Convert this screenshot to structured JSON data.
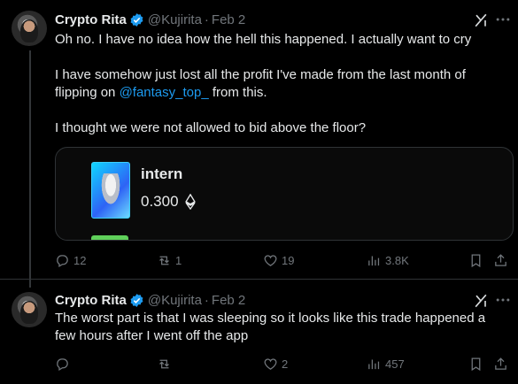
{
  "tweets": [
    {
      "author": {
        "name": "Crypto Rita",
        "handle": "@Kujirita",
        "date": "Feb 2",
        "verified": true
      },
      "text_before": "Oh no.  I have no idea how the hell this happened. I actually want to cry\n\nI have somehow just lost all the profit I've made from the last month of flipping on ",
      "mention": "@fantasy_top_",
      "text_after": " from this.\n\nI thought we were not allowed to bid above the floor?",
      "card": {
        "title": "intern",
        "price": "0.300",
        "currency_icon": "ethereum-icon"
      },
      "actions": {
        "replies": "12",
        "reposts": "1",
        "likes": "19",
        "views": "3.8K"
      }
    },
    {
      "author": {
        "name": "Crypto Rita",
        "handle": "@Kujirita",
        "date": "Feb 2",
        "verified": true
      },
      "text": "The worst part is that I was sleeping so it looks like this trade happened a few hours after I went off the app",
      "actions": {
        "replies": "",
        "reposts": "",
        "likes": "2",
        "views": "457"
      }
    }
  ],
  "icons": [
    "reply-icon",
    "repost-icon",
    "like-icon",
    "views-icon",
    "bookmark-icon",
    "share-icon",
    "grok-icon",
    "more-icon",
    "verified-icon"
  ],
  "colors": {
    "background": "#000000",
    "text": "#e7e9ea",
    "muted": "#71767b",
    "accent": "#1d9bf0",
    "border": "#2f3336"
  }
}
